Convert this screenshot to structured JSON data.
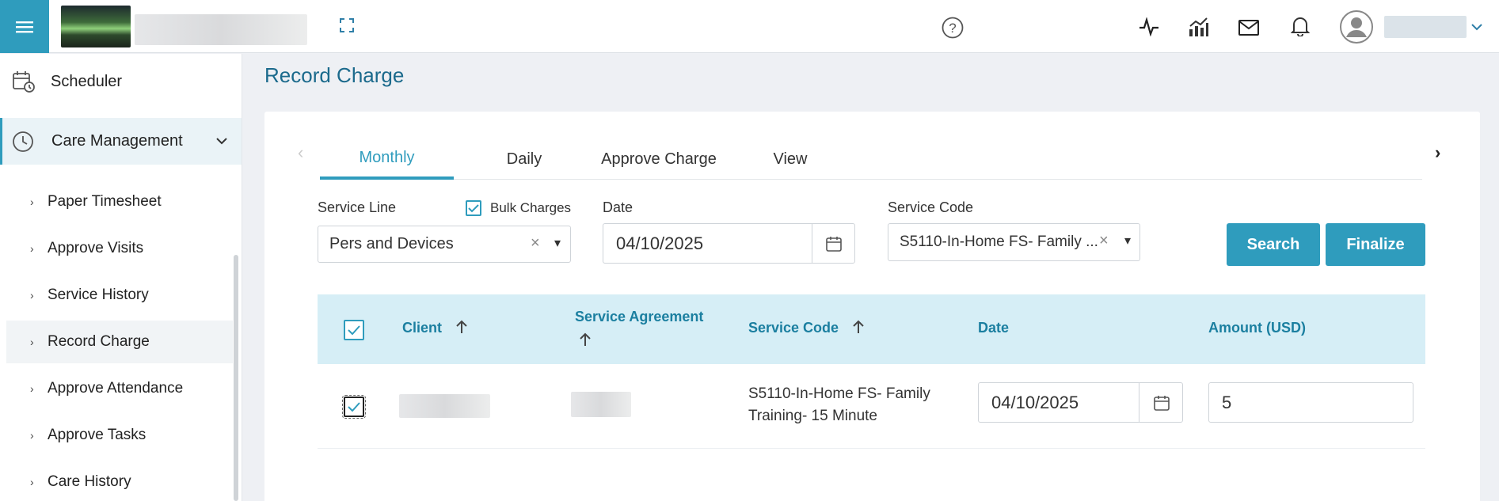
{
  "header": {
    "icons": [
      "menu-icon",
      "fullscreen-icon",
      "help-icon",
      "activity-icon",
      "analytics-icon",
      "mail-icon",
      "bell-icon",
      "avatar-icon",
      "chevron-down-icon"
    ]
  },
  "sidebar": {
    "scheduler": "Scheduler",
    "care_management": "Care Management",
    "sub_items": [
      {
        "label": "Paper Timesheet"
      },
      {
        "label": "Approve Visits"
      },
      {
        "label": "Service History"
      },
      {
        "label": "Record Charge"
      },
      {
        "label": "Approve Attendance"
      },
      {
        "label": "Approve Tasks"
      },
      {
        "label": "Care History"
      }
    ]
  },
  "page": {
    "title": "Record Charge"
  },
  "tabs": [
    "Monthly",
    "Daily",
    "Approve Charge",
    "View"
  ],
  "active_tab": "Monthly",
  "filters": {
    "service_line_label": "Service Line",
    "service_line_value": "Pers and Devices",
    "bulk_charges_label": "Bulk Charges",
    "bulk_charges_checked": true,
    "date_label": "Date",
    "date_value": "04/10/2025",
    "service_code_label": "Service Code",
    "service_code_value": "S5110-In-Home FS- Family ...",
    "clear_symbol": "×",
    "dropdown_symbol": "▾"
  },
  "buttons": {
    "search": "Search",
    "finalize": "Finalize"
  },
  "table": {
    "headers": {
      "client": "Client",
      "service_agreement": "Service Agreement",
      "service_code": "Service Code",
      "date": "Date",
      "amount": "Amount (USD)"
    },
    "rows": [
      {
        "checked": true,
        "service_code_line1": "S5110-In-Home FS- Family",
        "service_code_line2": "Training- 15 Minute",
        "date": "04/10/2025",
        "amount": "5"
      }
    ]
  },
  "colors": {
    "accent": "#2f9cbd",
    "title": "#1b6a8c",
    "header_bg": "#d6eef6"
  }
}
